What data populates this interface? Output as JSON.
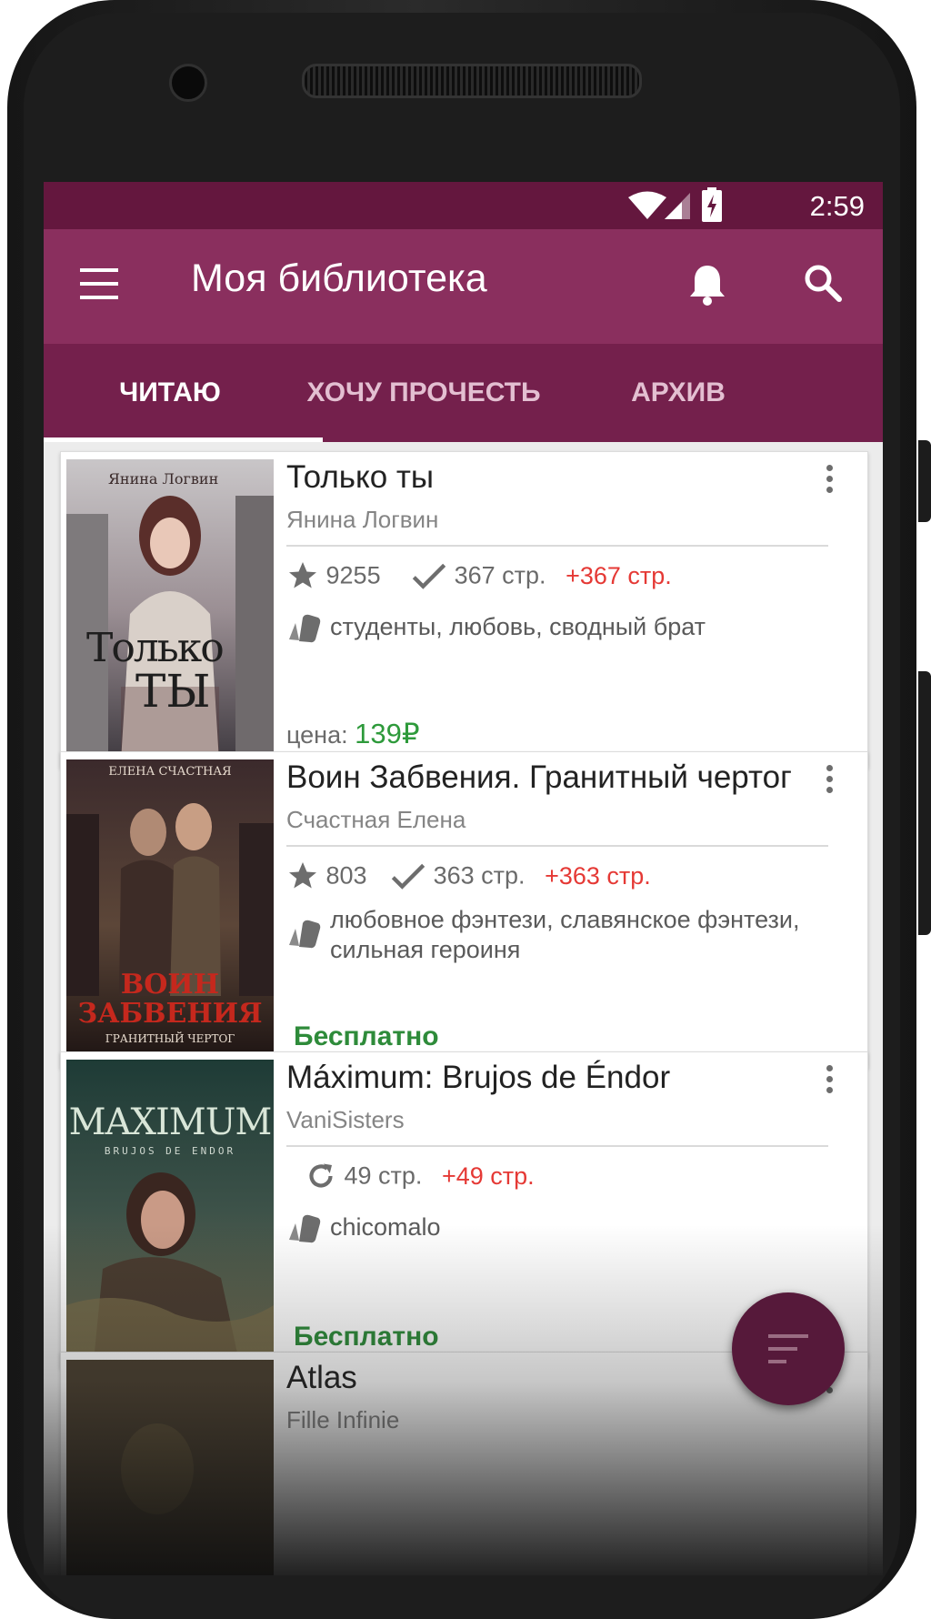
{
  "status": {
    "time": "2:59"
  },
  "header": {
    "title": "Моя библиотека"
  },
  "tabs": [
    {
      "label": "ЧИТАЮ",
      "active": true
    },
    {
      "label": "ХОЧУ ПРОЧЕСТЬ",
      "active": false
    },
    {
      "label": "АРХИВ",
      "active": false
    }
  ],
  "books": [
    {
      "title": "Только ты",
      "author": "Янина Логвин",
      "rating": "9255",
      "pages": "367 стр.",
      "new_pages": "+367 стр.",
      "tags": "студенты, любовь, сводный брат",
      "price_label": "цена:",
      "price": "139₽",
      "cover_author": "Янина Логвин",
      "cover_title_1": "Только",
      "cover_title_2": "ТЫ"
    },
    {
      "title": "Воин Забвения. Гранитный чертог",
      "author": "Счастная Елена",
      "rating": "803",
      "pages": "363 стр.",
      "new_pages": "+363 стр.",
      "tags": "любовное фэнтези, славянское фэнтези, сильная героиня",
      "free_label": "Бесплатно",
      "cover_author": "ЕЛЕНА СЧАСТНАЯ",
      "cover_title_1": "ВОИН",
      "cover_title_2": "ЗАБВЕНИЯ",
      "cover_subtitle": "ГРАНИТНЫЙ ЧЕРТОГ"
    },
    {
      "title": "Máximum: Brujos de Éndor",
      "author": "VaniSisters",
      "pages": "49 стр.",
      "new_pages": "+49 стр.",
      "tags": "chicomalo",
      "free_label": "Бесплатно",
      "cover_title_1": "MAXIMUM",
      "cover_subtitle": "BRUJOS DE ENDOR"
    },
    {
      "title": "Atlas",
      "author": "Fille Infinie"
    }
  ],
  "colors": {
    "status": "#64173e",
    "toolbar": "#8a2f5e",
    "tabs": "#74204c",
    "price": "#2e9a3b",
    "new_pages": "#e53935"
  }
}
